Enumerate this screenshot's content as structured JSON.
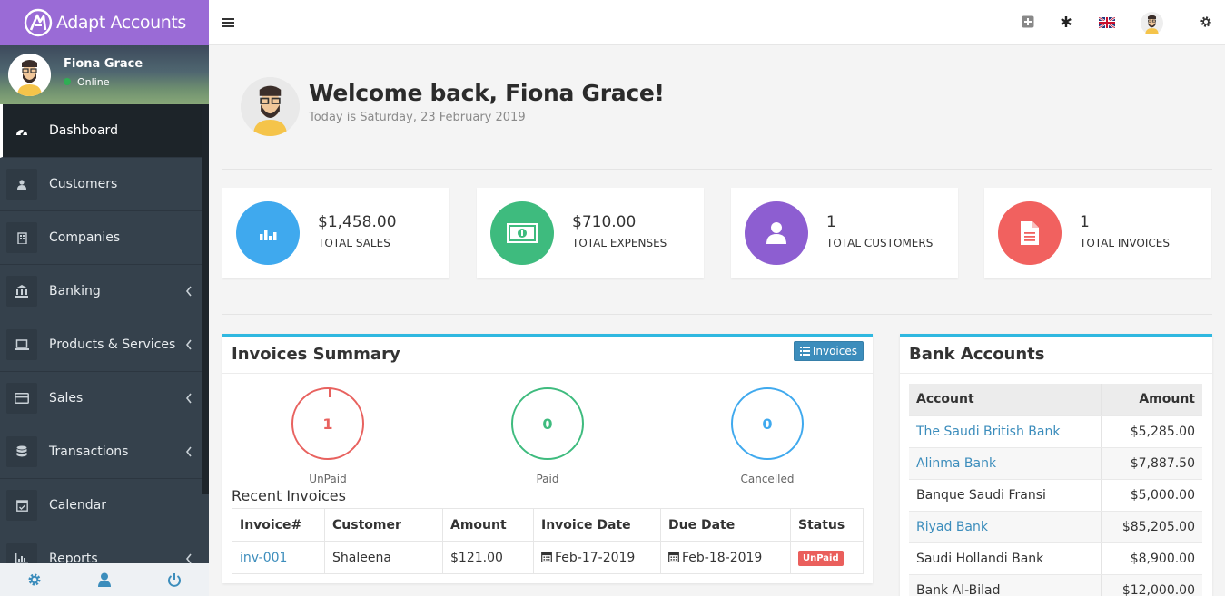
{
  "brand": {
    "name": "Adapt Accounts"
  },
  "user": {
    "name": "Fiona Grace",
    "status": "Online"
  },
  "sidebar": {
    "items": [
      {
        "label": "Dashboard",
        "icon": "dashboard-icon",
        "active": true
      },
      {
        "label": "Customers",
        "icon": "user-icon"
      },
      {
        "label": "Companies",
        "icon": "building-icon"
      },
      {
        "label": "Banking",
        "icon": "bank-icon",
        "submenu": true
      },
      {
        "label": "Products & Services",
        "icon": "laptop-icon",
        "submenu": true
      },
      {
        "label": "Sales",
        "icon": "credit-card-icon",
        "submenu": true
      },
      {
        "label": "Transactions",
        "icon": "database-icon",
        "submenu": true
      },
      {
        "label": "Calendar",
        "icon": "calendar-icon"
      },
      {
        "label": "Reports",
        "icon": "bar-chart-icon",
        "submenu": true
      }
    ],
    "footer": [
      "settings-icon",
      "user-icon",
      "power-icon"
    ]
  },
  "topbar": {
    "icons": [
      "hamburger-icon",
      "plus-square-icon",
      "asterisk-icon",
      "uk-flag-icon",
      "avatar",
      "gear-icon"
    ]
  },
  "welcome": {
    "title": "Welcome back, Fiona Grace!",
    "date": "Today is Saturday, 23 February 2019"
  },
  "stats": [
    {
      "value": "$1,458.00",
      "label": "TOTAL SALES",
      "color": "#3fa9ee",
      "icon": "bar-chart-icon"
    },
    {
      "value": "$710.00",
      "label": "TOTAL EXPENSES",
      "color": "#3ebb7e",
      "icon": "money-icon"
    },
    {
      "value": "1",
      "label": "TOTAL CUSTOMERS",
      "color": "#8d5ed1",
      "icon": "user-icon"
    },
    {
      "value": "1",
      "label": "TOTAL INVOICES",
      "color": "#f1615f",
      "icon": "file-icon"
    }
  ],
  "invoices_summary": {
    "title": "Invoices Summary",
    "button": "Invoices",
    "rings": [
      {
        "value": "1",
        "label": "UnPaid",
        "color": "#e8625f"
      },
      {
        "value": "0",
        "label": "Paid",
        "color": "#3ebb7e"
      },
      {
        "value": "0",
        "label": "Cancelled",
        "color": "#3fa9ee"
      }
    ],
    "recent_title": "Recent Invoices",
    "columns": [
      "Invoice#",
      "Customer",
      "Amount",
      "Invoice Date",
      "Due Date",
      "Status"
    ],
    "rows": [
      {
        "invoice": "inv-001",
        "customer": "Shaleena",
        "amount": "$121.00",
        "invoice_date": "Feb-17-2019",
        "due_date": "Feb-18-2019",
        "status": "UnPaid"
      }
    ]
  },
  "bank_accounts": {
    "title": "Bank Accounts",
    "columns": [
      "Account",
      "Amount"
    ],
    "rows": [
      {
        "account": "The Saudi British Bank",
        "amount": "$5,285.00",
        "link": true
      },
      {
        "account": "Alinma Bank",
        "amount": "$7,887.50",
        "link": true
      },
      {
        "account": "Banque Saudi Fransi",
        "amount": "$5,000.00",
        "link": false
      },
      {
        "account": "Riyad Bank",
        "amount": "$85,205.00",
        "link": true
      },
      {
        "account": "Saudi Hollandi Bank",
        "amount": "$8,900.00",
        "link": false
      },
      {
        "account": "Bank Al-Bilad",
        "amount": "$12,000.00",
        "link": false
      }
    ]
  }
}
